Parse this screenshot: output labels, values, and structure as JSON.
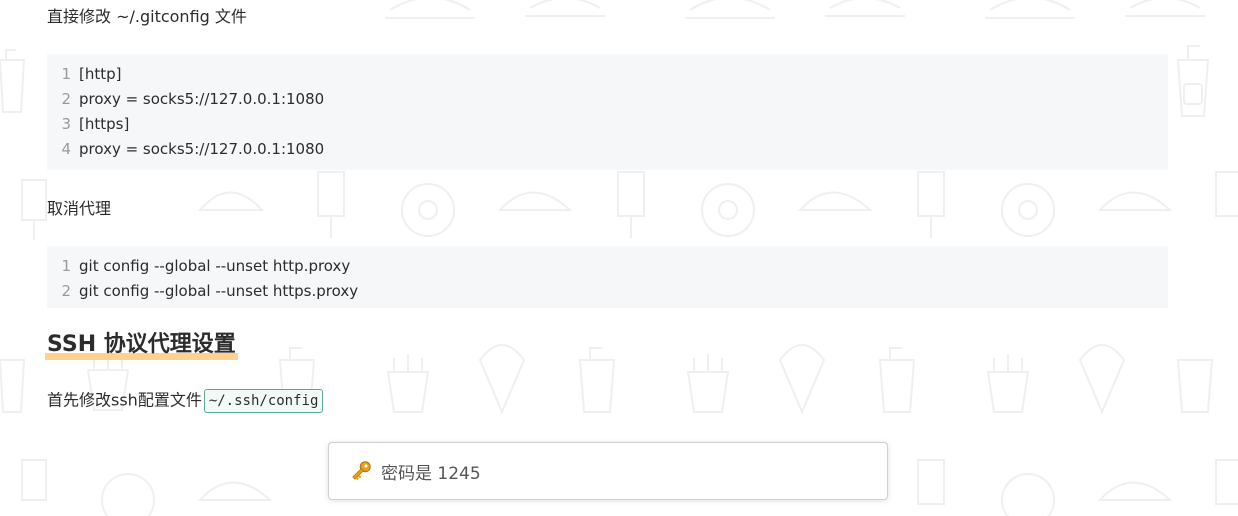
{
  "paragraphs": {
    "edit_gitconfig": "直接修改 ~/.gitconfig 文件",
    "cancel_proxy": "取消代理",
    "ssh_config_intro": "首先修改ssh配置文件"
  },
  "code_blocks": {
    "gitconfig": [
      {
        "n": "1",
        "text": "[http]"
      },
      {
        "n": "2",
        "text": "proxy = socks5://127.0.0.1:1080"
      },
      {
        "n": "3",
        "text": "[https]"
      },
      {
        "n": "4",
        "text": "proxy = socks5://127.0.0.1:1080"
      }
    ],
    "unset": [
      {
        "n": "1",
        "text": "git config --global --unset http.proxy"
      },
      {
        "n": "2",
        "text": "git config --global --unset https.proxy"
      }
    ]
  },
  "heading": "SSH 协议代理设置",
  "inline_code": "~/.ssh/config",
  "toast": {
    "icon": "key-icon",
    "text": "密码是 1245"
  },
  "colors": {
    "heading_underline": "#ffd28e",
    "code_bg": "#f6f7f8",
    "inline_code_border": "#5aa89a",
    "key_icon": "#e8a21a"
  }
}
